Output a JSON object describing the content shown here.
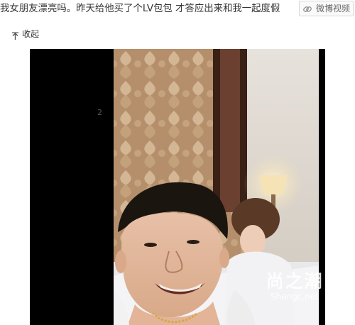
{
  "post": {
    "text": "我女朋友漂亮吗。昨天给他买了个LV包包 才答应出来和我一起度假"
  },
  "weibo_button": {
    "label": "微博视频",
    "icon": "link-icon"
  },
  "collapse": {
    "label": "收起",
    "icon": "arrow-up-icon"
  },
  "media": {
    "page_number": "2",
    "watermark_main": "尚之潮",
    "watermark_sub": "Shangc.net"
  }
}
